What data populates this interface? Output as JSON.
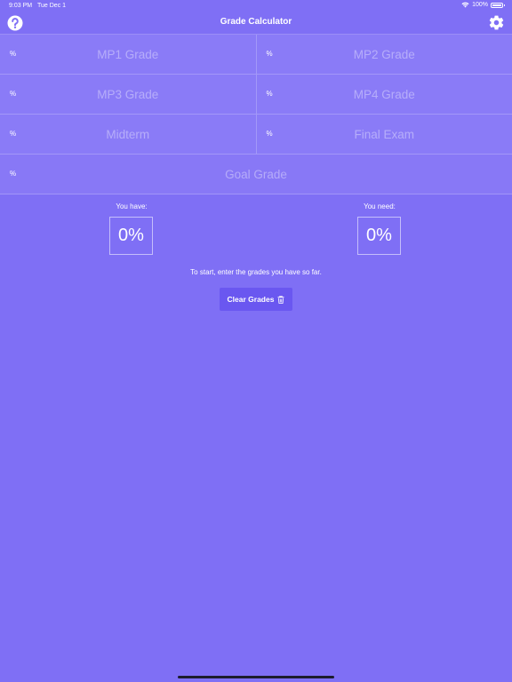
{
  "status_bar": {
    "time": "9:03 PM",
    "date": "Tue Dec 1",
    "battery": "100%",
    "battery_level": 1.0
  },
  "nav": {
    "title": "Grade Calculator",
    "help_icon": "question-circle-icon",
    "settings_icon": "gear-icon"
  },
  "fields": {
    "unit": "%",
    "mp1": "MP1 Grade",
    "mp2": "MP2 Grade",
    "mp3": "MP3 Grade",
    "mp4": "MP4 Grade",
    "midterm": "Midterm",
    "final": "Final Exam",
    "goal": "Goal Grade"
  },
  "results": {
    "have_label": "You have:",
    "have_value": "0%",
    "need_label": "You need:",
    "need_value": "0%"
  },
  "hint": "To start, enter the grades you have so far.",
  "clear_button": {
    "label": "Clear Grades",
    "icon": "trash-icon"
  },
  "colors": {
    "background": "#7f6ff5",
    "button": "#6a57f0"
  }
}
